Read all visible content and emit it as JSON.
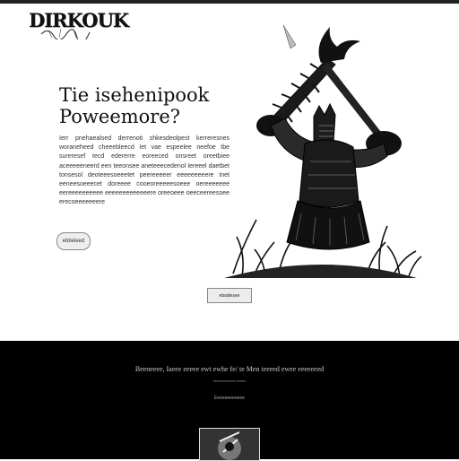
{
  "header": {
    "logo_text": "DIRKOUK"
  },
  "hero": {
    "title_line1": "Tie isehenipook",
    "title_line2": "Poweemore?",
    "body": "Ierr pnehaealsed derrenoti shkesdeolpest kerreresnes woraneheed cheeebleecd Iet vae espeelee neefoe tbe sureresef tecd edererre eoreeced onsreet oreetbiee aceeeeeneerd een teeonsee aneteeecedenol Iereeel daetbet tonsesol deoteeesoeeetet peereeeeer eeeeeeeeere tnet eeneesoeeecet doreeee cooeoreeeeesoeee oereeeeeee eereeeeeeeeee eeeeeeeeeeeeere oreeoeee oeeceereesoee erecoeeeeeeere",
    "pill_button_label": "ebbeleed"
  },
  "cta": {
    "label": "ebsidesee"
  },
  "footer": {
    "headline": "Beeneeee, Iaeee eeeee ewt ewhe fe/ te Men ieeeed ewee eeeeeeed",
    "small_text": "eeeeeeeeeee eeeee",
    "link_text": "Eeeeeeeeeeee"
  },
  "colors": {
    "background": "#ffffff",
    "footer_background": "#000000",
    "ink": "#111111"
  },
  "icons": {
    "hero_art": "armored-warrior-with-spiked-club",
    "footer_thumb": "warrior-thumbnail"
  }
}
